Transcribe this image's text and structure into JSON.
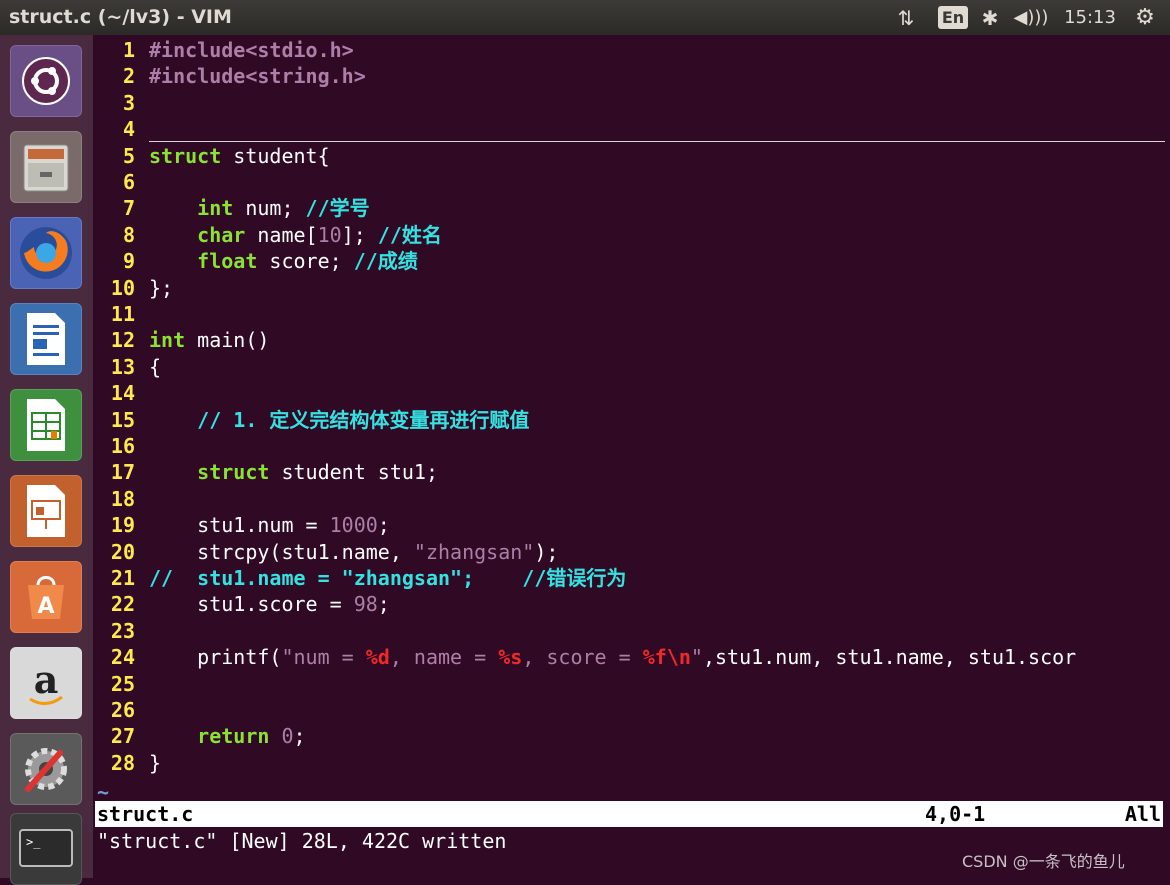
{
  "topbar": {
    "title": "struct.c (~/lv3) - VIM",
    "lang": "En",
    "clock": "15:13",
    "icons": [
      "network-icon",
      "keyboard-language-icon",
      "bluetooth-icon",
      "volume-icon",
      "settings-gear-icon"
    ]
  },
  "launcher": {
    "items": [
      "ubuntu-dash",
      "files",
      "firefox",
      "libreoffice-writer",
      "libreoffice-calc",
      "libreoffice-impress",
      "ubuntu-software",
      "amazon",
      "system-settings",
      "terminal"
    ]
  },
  "editor": {
    "lines": [
      {
        "n": "1",
        "segs": [
          [
            "pp",
            "#include<stdio.h>"
          ]
        ]
      },
      {
        "n": "2",
        "segs": [
          [
            "pp",
            "#include<string.h>"
          ]
        ]
      },
      {
        "n": "3",
        "segs": []
      },
      {
        "n": "4",
        "segs": []
      },
      {
        "n": "5",
        "segs": [
          [
            "kw",
            "struct"
          ],
          [
            "cl",
            " student{"
          ]
        ]
      },
      {
        "n": "6",
        "segs": []
      },
      {
        "n": "7",
        "segs": [
          [
            "cl",
            "    "
          ],
          [
            "kw",
            "int"
          ],
          [
            "cl",
            " num; "
          ],
          [
            "cm",
            "//学号"
          ]
        ]
      },
      {
        "n": "8",
        "segs": [
          [
            "cl",
            "    "
          ],
          [
            "kw",
            "char"
          ],
          [
            "cl",
            " name["
          ],
          [
            "num",
            "10"
          ],
          [
            "cl",
            "]; "
          ],
          [
            "cm",
            "//姓名"
          ]
        ]
      },
      {
        "n": "9",
        "segs": [
          [
            "cl",
            "    "
          ],
          [
            "kw",
            "float"
          ],
          [
            "cl",
            " score; "
          ],
          [
            "cm",
            "//成绩"
          ]
        ]
      },
      {
        "n": "10",
        "segs": [
          [
            "cl",
            "};"
          ]
        ]
      },
      {
        "n": "11",
        "segs": []
      },
      {
        "n": "12",
        "segs": [
          [
            "kw",
            "int"
          ],
          [
            "cl",
            " main()"
          ]
        ]
      },
      {
        "n": "13",
        "segs": [
          [
            "cl",
            "{"
          ]
        ]
      },
      {
        "n": "14",
        "segs": []
      },
      {
        "n": "15",
        "segs": [
          [
            "cl",
            "    "
          ],
          [
            "cm",
            "// 1. 定义完结构体变量再进行赋值"
          ]
        ]
      },
      {
        "n": "16",
        "segs": []
      },
      {
        "n": "17",
        "segs": [
          [
            "cl",
            "    "
          ],
          [
            "kw",
            "struct"
          ],
          [
            "cl",
            " student stu1;"
          ]
        ]
      },
      {
        "n": "18",
        "segs": []
      },
      {
        "n": "19",
        "segs": [
          [
            "cl",
            "    stu1.num = "
          ],
          [
            "num",
            "1000"
          ],
          [
            "cl",
            ";"
          ]
        ]
      },
      {
        "n": "20",
        "segs": [
          [
            "cl",
            "    strcpy(stu1.name, "
          ],
          [
            "str",
            "\"zhangsan\""
          ],
          [
            "cl",
            ");"
          ]
        ]
      },
      {
        "n": "21",
        "segs": [
          [
            "cm",
            "//  stu1.name = \"zhangsan\";    //错误行为"
          ]
        ]
      },
      {
        "n": "22",
        "segs": [
          [
            "cl",
            "    stu1.score = "
          ],
          [
            "num",
            "98"
          ],
          [
            "cl",
            ";"
          ]
        ]
      },
      {
        "n": "23",
        "segs": []
      },
      {
        "n": "24",
        "segs": [
          [
            "cl",
            "    printf("
          ],
          [
            "str",
            "\"num = "
          ],
          [
            "esc",
            "%d"
          ],
          [
            "str",
            ", name = "
          ],
          [
            "esc",
            "%s"
          ],
          [
            "str",
            ", score = "
          ],
          [
            "esc",
            "%f\\n"
          ],
          [
            "str",
            "\""
          ],
          [
            "cl",
            ",stu1.num, stu1.name, stu1.scor"
          ]
        ]
      },
      {
        "n": "25",
        "segs": []
      },
      {
        "n": "26",
        "segs": []
      },
      {
        "n": "27",
        "segs": [
          [
            "cl",
            "    "
          ],
          [
            "kw",
            "return"
          ],
          [
            "cl",
            " "
          ],
          [
            "num",
            "0"
          ],
          [
            "cl",
            ";"
          ]
        ]
      },
      {
        "n": "28",
        "segs": [
          [
            "cl",
            "}"
          ]
        ]
      }
    ],
    "tilde": "~"
  },
  "statusline": {
    "file": "struct.c",
    "pos": "4,0-1",
    "scroll": "All"
  },
  "message": "\"struct.c\" [New] 28L, 422C written",
  "watermark": "CSDN @一条飞的鱼儿",
  "colors": {
    "bg": "#300a24",
    "linenr": "#fce94f",
    "keyword": "#8ae234",
    "comment": "#34e2e2",
    "constant": "#ad7fa8",
    "special": "#ef2929"
  }
}
